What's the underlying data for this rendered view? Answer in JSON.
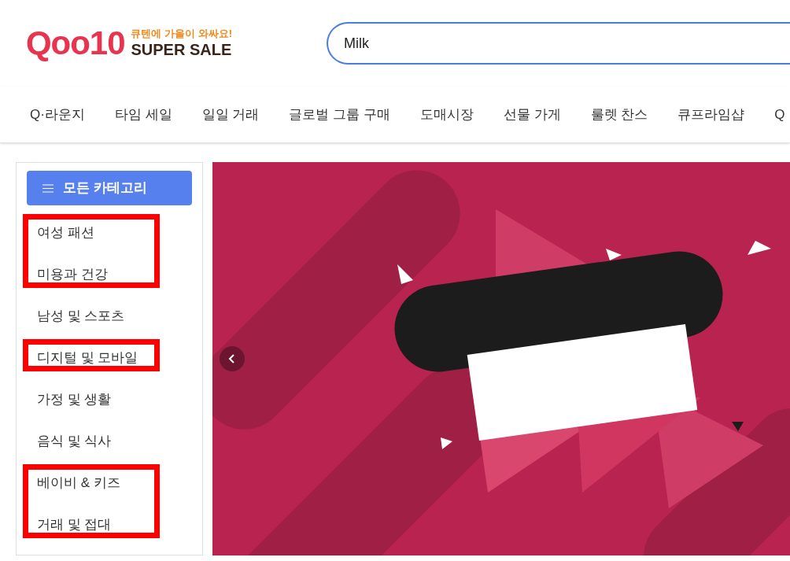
{
  "logo": {
    "brand": "Qoo10",
    "slogan": "큐텐에 가을이 와싸요!",
    "campaign": "SUPER SALE"
  },
  "search": {
    "value": "Milk"
  },
  "nav": [
    "Q·라운지",
    "타임 세일",
    "일일 거래",
    "글로벌 그룹 구매",
    "도매시장",
    "선물 가게",
    "룰렛 찬스",
    "큐프라임샵",
    "Q"
  ],
  "sidebar": {
    "button": "모든 카테고리",
    "groups": [
      {
        "highlighted": true,
        "items": [
          "여성 패션",
          "미용과 건강"
        ]
      },
      {
        "highlighted": false,
        "items": [
          "남성 및 스포츠"
        ]
      },
      {
        "highlighted": true,
        "items": [
          "디지털 및 모바일"
        ]
      },
      {
        "highlighted": false,
        "items": [
          "가정 및 생활",
          "음식 및 식사"
        ]
      },
      {
        "highlighted": true,
        "items": [
          "베이비 & 키즈",
          "거래 및 접대"
        ]
      }
    ]
  }
}
